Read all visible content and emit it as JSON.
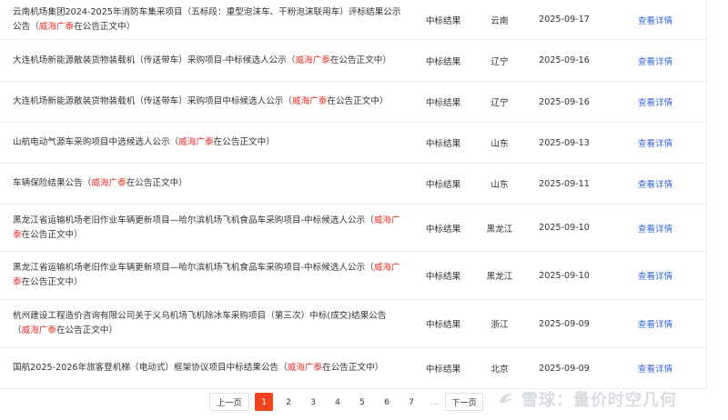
{
  "rows": [
    {
      "title_pre": "云南机场集团2024-2025年消防车集采项目（五标段：重型泡沫车、干粉泡沫联用车）评标结果公示公告（",
      "title_hl": "威海广泰",
      "title_post": "在公告正文中）",
      "type": "中标结果",
      "region": "云南",
      "date": "2025-09-17",
      "link": "查看详情"
    },
    {
      "title_pre": "大连机场新能源散装货物装载机（传送带车）采购项目-中标候选人公示（",
      "title_hl": "威海广泰",
      "title_post": "在公告正文中）",
      "type": "中标结果",
      "region": "辽宁",
      "date": "2025-09-16",
      "link": "查看详情"
    },
    {
      "title_pre": "大连机场新能源散装货物装载机（传送带车）采购项目中标候选人公示（",
      "title_hl": "威海广泰",
      "title_post": "在公告正文中）",
      "type": "中标结果",
      "region": "辽宁",
      "date": "2025-09-16",
      "link": "查看详情"
    },
    {
      "title_pre": "山航电动气源车采购项目中选候选人公示（",
      "title_hl": "威海广泰",
      "title_post": "在公告正文中）",
      "type": "中标结果",
      "region": "山东",
      "date": "2025-09-13",
      "link": "查看详情"
    },
    {
      "title_pre": "车辆保险结果公告（",
      "title_hl": "威海广泰",
      "title_post": "在公告正文中）",
      "type": "中标结果",
      "region": "山东",
      "date": "2025-09-11",
      "link": "查看详情"
    },
    {
      "title_pre": "黑龙江省运输机场老旧作业车辆更新项目—哈尔滨机场飞机食品车采购项目-中标候选人公示（",
      "title_hl": "威海广泰",
      "title_post": "在公告正文中）",
      "type": "中标结果",
      "region": "黑龙江",
      "date": "2025-09-10",
      "link": "查看详情"
    },
    {
      "title_pre": "黑龙江省运输机场老旧作业车辆更新项目—哈尔滨机场飞机食品车采购项目-中标候选人公示（",
      "title_hl": "威海广泰",
      "title_post": "在公告正文中）",
      "type": "中标结果",
      "region": "黑龙江",
      "date": "2025-09-10",
      "link": "查看详情"
    },
    {
      "title_pre": "杭州建设工程造价咨询有限公司关于义乌机场飞机除冰车采购项目（第三次）中标(成交)结果公告（",
      "title_hl": "威海广泰",
      "title_post": "在公告正文中）",
      "type": "中标结果",
      "region": "浙江",
      "date": "2025-09-09",
      "link": "查看详情"
    },
    {
      "title_pre": "国航2025-2026年旅客登机梯（电动式）框架协议项目中标结果公告（",
      "title_hl": "威海广泰",
      "title_post": "在公告正文中）",
      "type": "中标结果",
      "region": "北京",
      "date": "2025-09-09",
      "link": "查看详情"
    }
  ],
  "pagination": {
    "prev": "上一页",
    "pages": [
      "1",
      "2",
      "3",
      "4",
      "5",
      "6",
      "7"
    ],
    "active": "1",
    "dots": "…",
    "next": "下一页"
  },
  "watermark": {
    "text": "雪球：量价时空几何",
    "icon": "snowball-logo-icon"
  }
}
